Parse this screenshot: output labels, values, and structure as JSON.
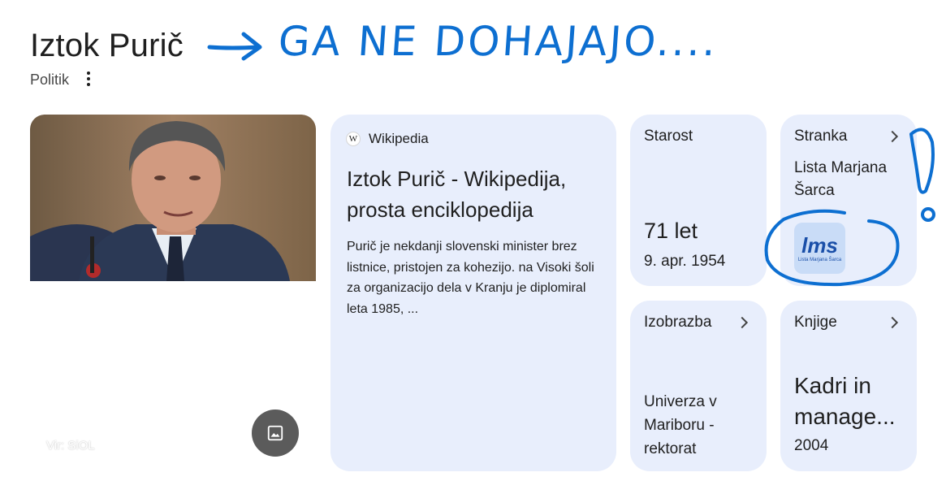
{
  "header": {
    "title": "Iztok Purič",
    "subtitle": "Politik"
  },
  "annotation": {
    "scribble_text": "GA NE DOHAJAJO....",
    "color": "#0d6fd1"
  },
  "photo": {
    "credit": "Vir: SiOL",
    "image_button_icon": "image-icon"
  },
  "wiki": {
    "source": "Wikipedia",
    "logo_letter": "W",
    "title": "Iztok Purič - Wikipedija, prosta enciklopedija",
    "snippet": "Purič je nekdanji slovenski minister brez listnice, pristojen za kohezijo. na Visoki šoli za organizacijo dela v Kranju je diplomiral leta 1985, ..."
  },
  "age": {
    "label": "Starost",
    "value": "71 let",
    "birth_date": "9. apr. 1954"
  },
  "party": {
    "label": "Stranka",
    "name": "Lista Marjana Šarca",
    "logo_text": "lms",
    "logo_caption": "Lista Marjana Šarca"
  },
  "education": {
    "label": "Izobrazba",
    "value": "Univerza v Mariboru - rektorat"
  },
  "books": {
    "label": "Knjige",
    "value": "Kadri in manage...",
    "year": "2004"
  },
  "colors": {
    "card_bg": "#e8eefc",
    "text": "#1f1f1f",
    "pen": "#0d6fd1"
  }
}
